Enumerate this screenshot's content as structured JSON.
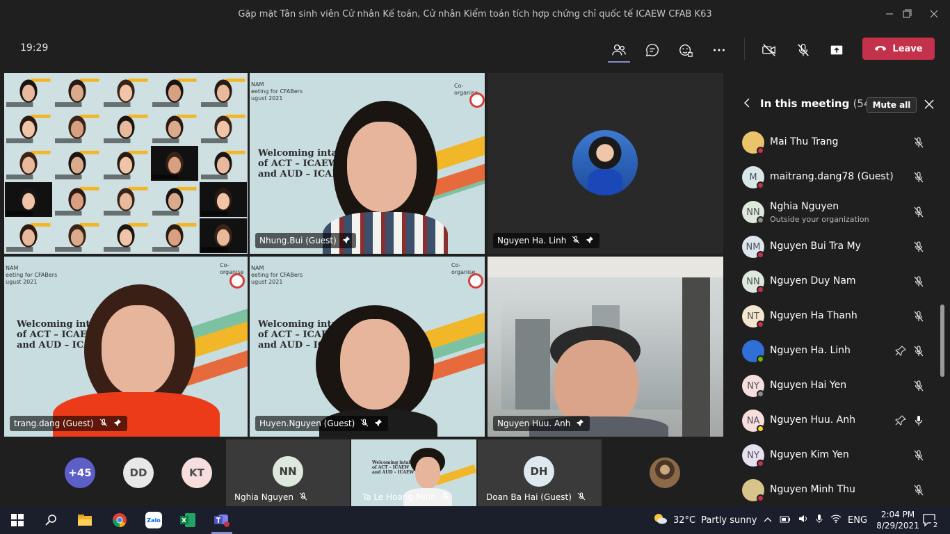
{
  "window": {
    "title": "Gặp mặt Tân sinh viên Cử nhân Kế toán, Cử nhân Kiểm toán tích hợp chứng chỉ quốc tế ICAEW CFAB K63",
    "controls": [
      "minimize",
      "maximize",
      "close"
    ]
  },
  "toolbar": {
    "time": "19:29",
    "icons": [
      "people-icon",
      "chat-icon",
      "reactions-icon",
      "more-icon",
      "camera-off-icon",
      "mic-off-icon",
      "share-icon"
    ],
    "leave_label": "Leave",
    "leave_color": "#c4314b",
    "active_underline_color": "#8b8cc7"
  },
  "grid": {
    "tiles": [
      {
        "id": "gallery",
        "label": ""
      },
      {
        "id": "nhung",
        "label": "Nhung.Bui (Guest)",
        "muted": false,
        "pinned": true
      },
      {
        "id": "linh",
        "label": "Nguyen Ha. Linh",
        "muted": true,
        "pinned": true
      },
      {
        "id": "trang",
        "label": "trang.dang (Guest)",
        "muted": true,
        "pinned": true
      },
      {
        "id": "huyen",
        "label": "Huyen.Nguyen (Guest)",
        "muted": true,
        "pinned": true
      },
      {
        "id": "anh",
        "label": "Nguyen Huu. Anh",
        "muted": false,
        "pinned": true
      }
    ],
    "slide_text": {
      "header_left": "NAM\neeting for CFABers\nugust 2021",
      "co_organise": "Co-organise",
      "welcome_lines": [
        "Welcoming intake 63",
        "of ACT – ICAEW",
        "and AUD – ICAEW"
      ]
    }
  },
  "strip": {
    "overflow": "+45",
    "avatars": [
      {
        "initials": "DD",
        "bg": "#e8e8e8"
      },
      {
        "initials": "KT",
        "bg": "#f6dede"
      }
    ],
    "tiles": [
      {
        "initials": "NN",
        "name": "Nghia Nguyen",
        "muted": true
      },
      {
        "initials": "",
        "name": "Ta Le Hoang Minh",
        "muted": true
      },
      {
        "initials": "DH",
        "name": "Doan Ba Hai (Guest)",
        "muted": true
      }
    ]
  },
  "panel": {
    "title": "In this meeting",
    "count": "(54)",
    "mute_all": "Mute all",
    "participants": [
      {
        "initials": "",
        "name": "Mai Thu Trang",
        "sub": "",
        "avatar_bg": "#e9c46a",
        "status": "#c4314b",
        "pinned": false,
        "mic": "off"
      },
      {
        "initials": "M",
        "name": "maitrang.dang78 (Guest)",
        "sub": "",
        "avatar_bg": "#d8e8e8",
        "status": "#c4314b",
        "pinned": false,
        "mic": "off"
      },
      {
        "initials": "NN",
        "name": "Nghia Nguyen",
        "sub": "Outside your organization",
        "avatar_bg": "#dde9dd",
        "status": "#8a8a8a",
        "pinned": false,
        "mic": "off"
      },
      {
        "initials": "NM",
        "name": "Nguyen Bui Tra My",
        "sub": "",
        "avatar_bg": "#dde6ef",
        "status": "#c4314b",
        "pinned": false,
        "mic": "off"
      },
      {
        "initials": "NN",
        "name": "Nguyen Duy Nam",
        "sub": "",
        "avatar_bg": "#dde9dd",
        "status": "#c4314b",
        "pinned": false,
        "mic": "off"
      },
      {
        "initials": "NT",
        "name": "Nguyen Ha Thanh",
        "sub": "",
        "avatar_bg": "#f5e7cf",
        "status": "#c4314b",
        "pinned": false,
        "mic": "off"
      },
      {
        "initials": "",
        "name": "Nguyen Ha. Linh",
        "sub": "",
        "avatar_bg": "#2f6fd6",
        "status": "#6bb700",
        "pinned": true,
        "mic": "off"
      },
      {
        "initials": "NY",
        "name": "Nguyen Hai Yen",
        "sub": "",
        "avatar_bg": "#f6dede",
        "status": "#8a8a8a",
        "pinned": false,
        "mic": "off"
      },
      {
        "initials": "NA",
        "name": "Nguyen Huu. Anh",
        "sub": "",
        "avatar_bg": "#f6dede",
        "status": "#f8d22a",
        "pinned": true,
        "mic": "on"
      },
      {
        "initials": "NY",
        "name": "Nguyen Kim Yen",
        "sub": "",
        "avatar_bg": "#e6e0f0",
        "status": "#c4314b",
        "pinned": false,
        "mic": "off"
      },
      {
        "initials": "",
        "name": "Nguyen Minh Thu",
        "sub": "",
        "avatar_bg": "#d7c48a",
        "status": "#c4314b",
        "pinned": false,
        "mic": "off"
      }
    ]
  },
  "taskbar": {
    "apps": [
      "start-icon",
      "search-icon",
      "file-explorer-icon",
      "chrome-icon",
      "zalo-icon",
      "excel-icon",
      "teams-icon"
    ],
    "zalo_label": "Zalo",
    "weather_temp": "32°C",
    "weather_desc": "Partly sunny",
    "lang": "ENG",
    "clock_time": "2:04 PM",
    "clock_date": "8/29/2021",
    "notifications": "2"
  }
}
